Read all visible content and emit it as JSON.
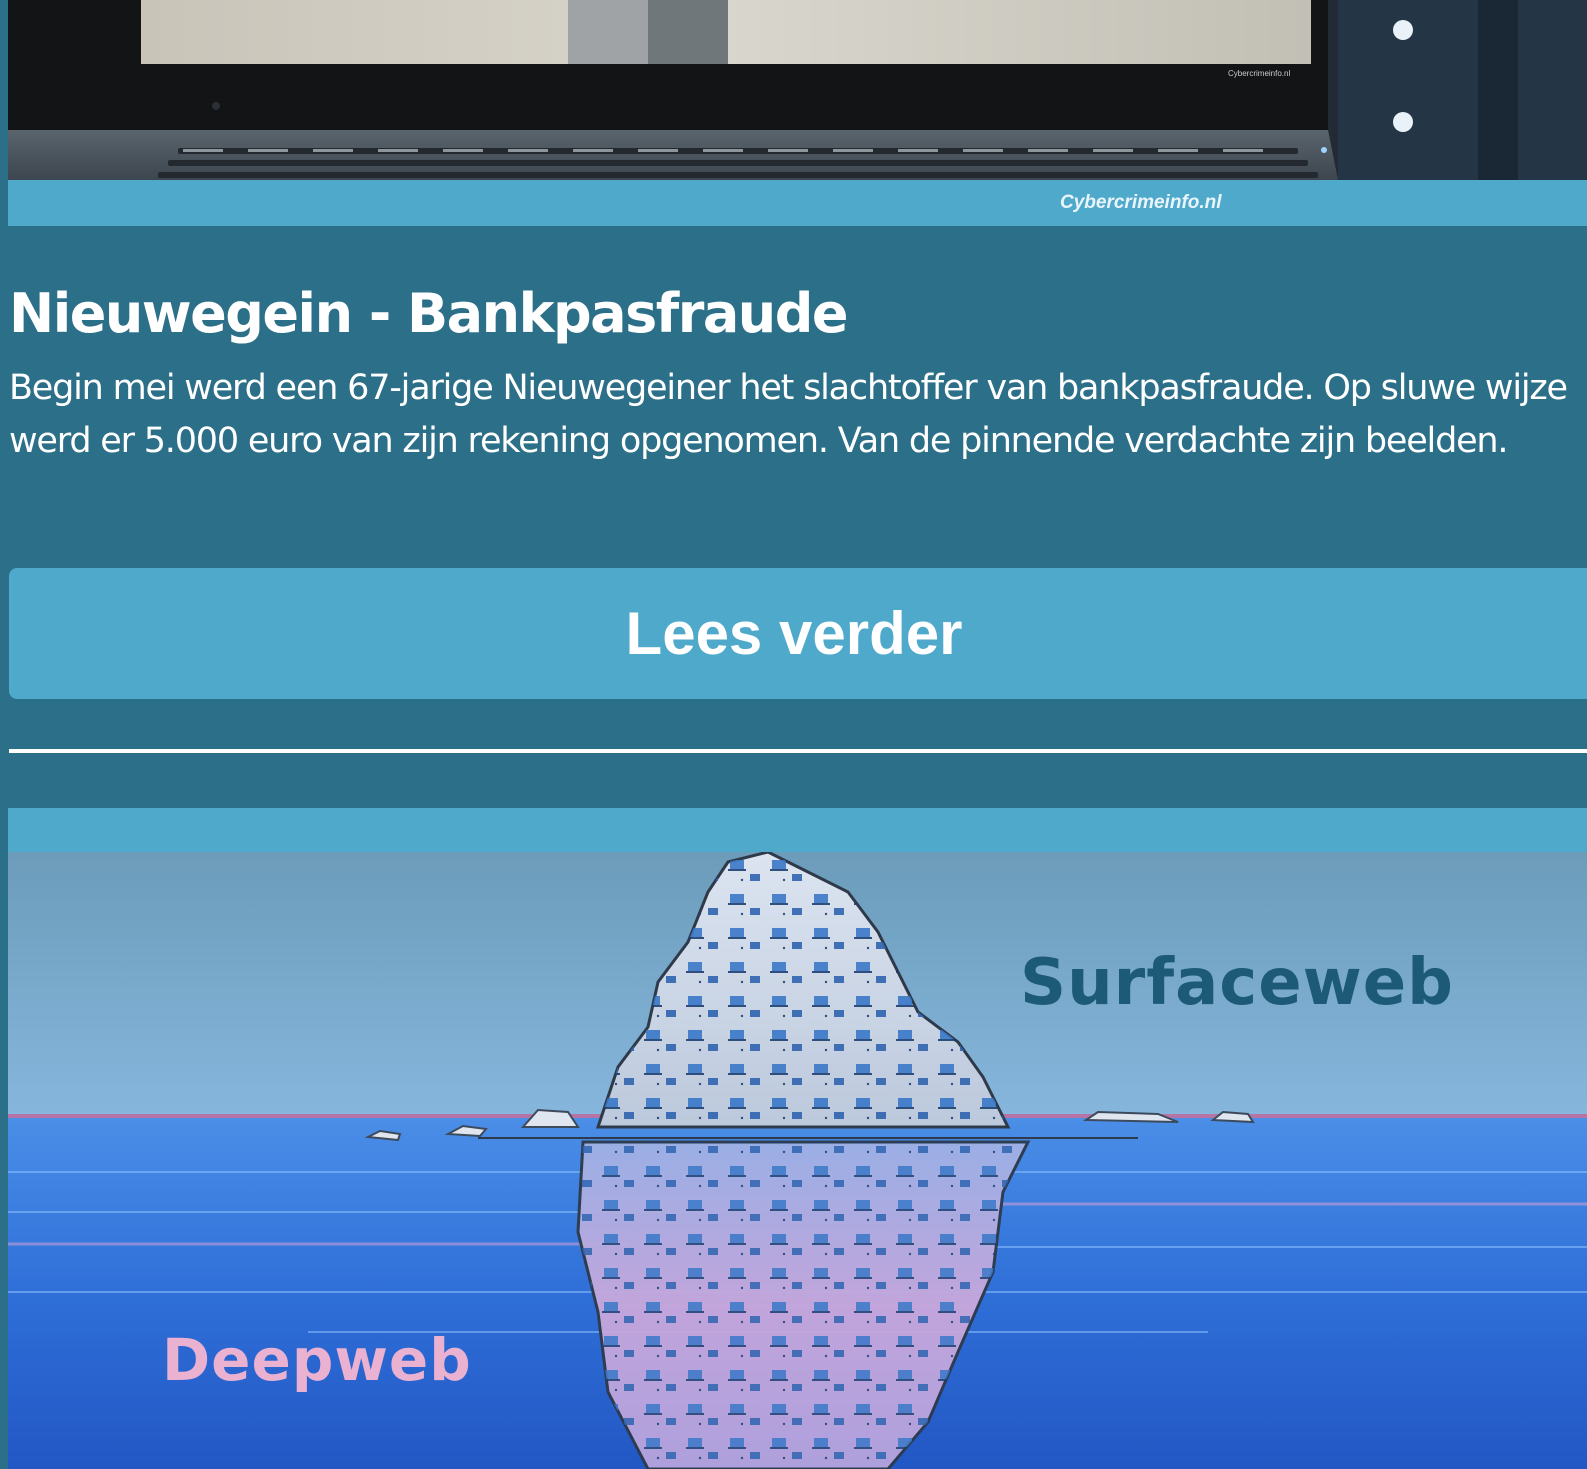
{
  "article_1": {
    "image_caption": "Cybercrimeinfo.nl",
    "image_screen_watermark": "Cybercrimeinfo.nl",
    "title": "Nieuwegein - Bankpasfraude",
    "body": "Begin mei werd een 67-jarige Nieuwegeiner het slachtoffer van bankpasfraude. Op sluwe wijze werd er 5.000 euro van zijn rekening opgenomen. Van de pinnende verdachte zijn beelden.",
    "read_more_label": "Lees verder"
  },
  "article_2": {
    "image_labels": {
      "surface": "Surfaceweb",
      "deep": "Deepweb"
    }
  },
  "colors": {
    "page_background": "#2c6f88",
    "accent_bar": "#4ea9cb",
    "text": "#ffffff",
    "surface_label": "#1c5a78",
    "deep_label": "#eab1d0"
  }
}
